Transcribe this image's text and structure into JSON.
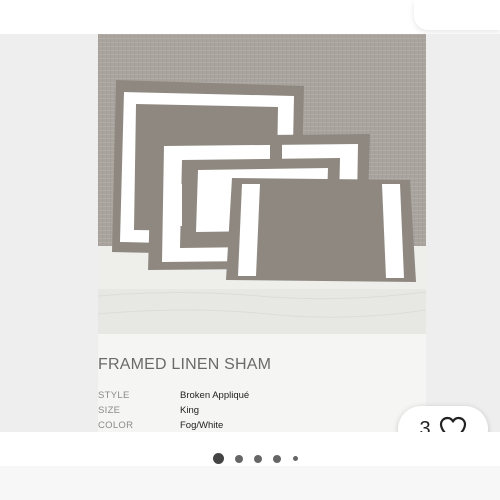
{
  "listing": {
    "product_title": "FRAMED LINEN SHAM",
    "specs": [
      {
        "key": "STYLE",
        "value": "Broken Appliqué"
      },
      {
        "key": "SIZE",
        "value": "King"
      },
      {
        "key": "COLOR",
        "value": "Fog/White"
      }
    ]
  },
  "like": {
    "count": "3",
    "icon": "heart-icon"
  },
  "carousel": {
    "slide_count": 5,
    "active_index": 0
  },
  "colors": {
    "wall": "#a8a39c",
    "fog": "#8e8880",
    "white": "#ffffff",
    "bed": "#efefec"
  }
}
